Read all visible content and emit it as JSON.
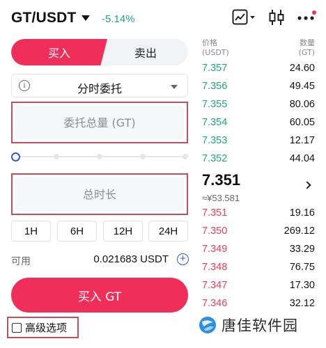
{
  "header": {
    "pair": "GT/USDT",
    "change": "-5.14%",
    "icons": [
      "chart-line-icon",
      "candlestick-icon",
      "more-icon"
    ]
  },
  "trade_tabs": {
    "buy": "买入",
    "sell": "卖出",
    "selected": "buy"
  },
  "order_type": {
    "value": "分时委托"
  },
  "amount_field": {
    "placeholder": "委托总量 (GT)"
  },
  "amount_slider": {
    "level": 0
  },
  "duration_field": {
    "placeholder": "总时长"
  },
  "duration_options": [
    "1H",
    "6H",
    "12H",
    "24H"
  ],
  "available": {
    "label": "可用",
    "value": "0.021683 USDT"
  },
  "buy_button": {
    "label": "买入 GT"
  },
  "advanced": {
    "label": "高级选项",
    "checked": false
  },
  "order_book": {
    "price_header": "价格",
    "price_unit": "(USDT)",
    "qty_header": "数量",
    "qty_unit": "(GT)",
    "asks": [
      {
        "price": "7.357",
        "qty": "24.60"
      },
      {
        "price": "7.356",
        "qty": "49.45"
      },
      {
        "price": "7.355",
        "qty": "80.06"
      },
      {
        "price": "7.354",
        "qty": "60.05"
      },
      {
        "price": "7.353",
        "qty": "12.17"
      },
      {
        "price": "7.352",
        "qty": "44.04"
      }
    ],
    "last_price": "7.351",
    "last_price_fiat": "≈¥53.581",
    "bids": [
      {
        "price": "7.351",
        "qty": "19.16"
      },
      {
        "price": "7.350",
        "qty": "269.12"
      },
      {
        "price": "7.349",
        "qty": "33.29"
      },
      {
        "price": "7.348",
        "qty": "76.75"
      },
      {
        "price": "7.347",
        "qty": "17.30"
      },
      {
        "price": "7.346",
        "qty": "32.12"
      }
    ],
    "colors": {
      "ask": "#1fa77a",
      "bid": "#e83e59"
    }
  },
  "watermark": {
    "text": "唐佳软件园"
  },
  "colors": {
    "accent": "#f02e5a",
    "link": "#2f5bd8"
  }
}
